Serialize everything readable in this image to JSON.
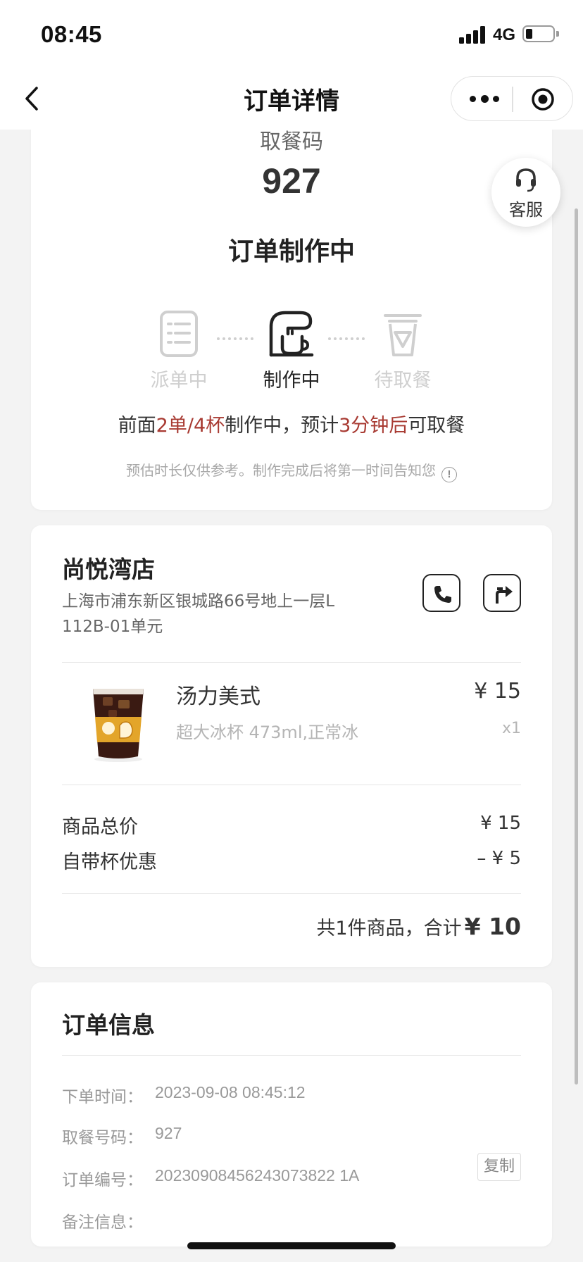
{
  "status_bar": {
    "time": "08:45",
    "network": "4G"
  },
  "nav": {
    "title": "订单详情"
  },
  "pickup": {
    "label": "取餐码",
    "code": "927",
    "status": "订单制作中",
    "steps": [
      {
        "label": "派单中",
        "icon": "receipt-list-icon",
        "state": "done"
      },
      {
        "label": "制作中",
        "icon": "coffee-machine-icon",
        "state": "active"
      },
      {
        "label": "待取餐",
        "icon": "cup-icon",
        "state": "pending"
      }
    ],
    "queue": {
      "prefix": "前面",
      "orders": "2单/4杯",
      "middle": "制作中，预计",
      "eta": "3分钟后",
      "suffix": "可取餐"
    },
    "notice": "预估时长仅供参考。制作完成后将第一时间告知您"
  },
  "service": {
    "label": "客服"
  },
  "store": {
    "name": "尚悦湾店",
    "address": "上海市浦东新区银城路66号地上一层L112B-01单元"
  },
  "product": {
    "name": "汤力美式",
    "spec": "超大冰杯 473ml,正常冰",
    "price": "¥ 15",
    "qty": "x1"
  },
  "summary": {
    "subtotal_label": "商品总价",
    "subtotal_value": "¥ 15",
    "discount_label": "自带杯优惠",
    "discount_value": "–  ¥ 5",
    "total_prefix": "共1件商品，合计",
    "total_value": "¥ 10"
  },
  "order_info": {
    "title": "订单信息",
    "rows": [
      {
        "key": "下单时间：",
        "value": "2023-09-08 08:45:12"
      },
      {
        "key": "取餐号码：",
        "value": "927"
      },
      {
        "key": "订单编号：",
        "value": "20230908456243073822 1A"
      },
      {
        "key": "备注信息：",
        "value": ""
      }
    ],
    "copy_label": "复制"
  },
  "colors": {
    "highlight": "#a83a32",
    "background": "#f3f3f3"
  }
}
